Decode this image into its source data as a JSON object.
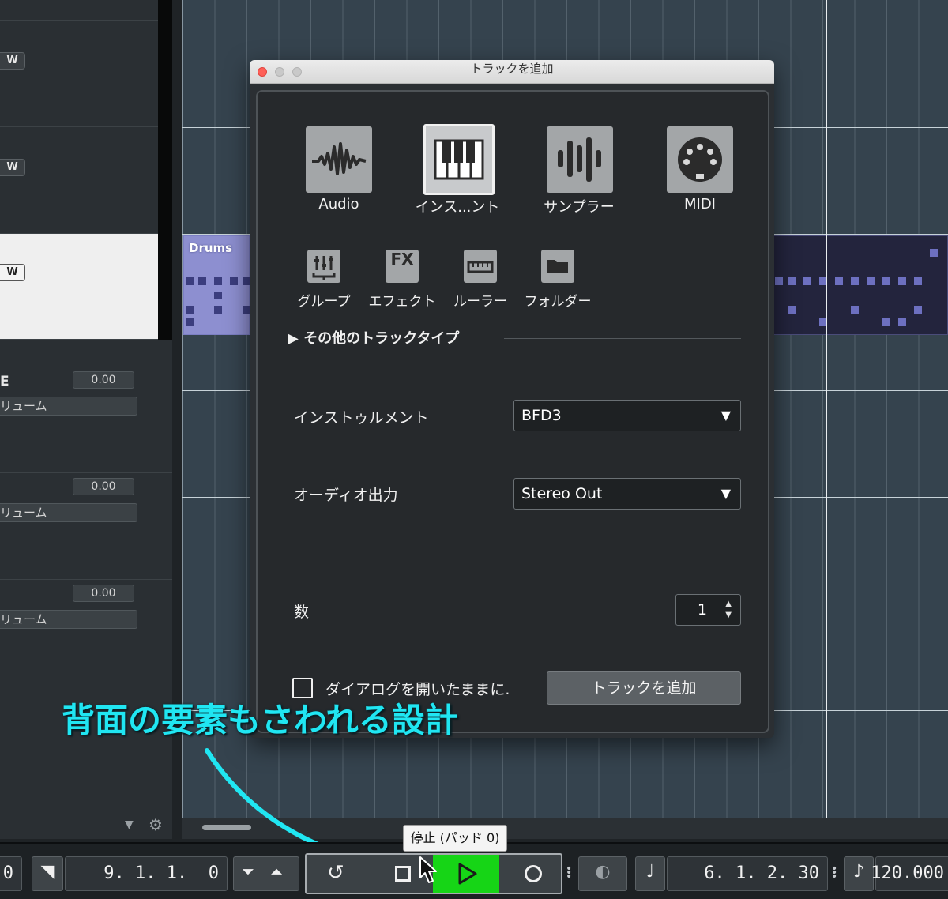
{
  "tracks": {
    "w_label": "W",
    "rows": [
      {
        "name": "E",
        "value": "0.00",
        "volume": "リューム"
      },
      {
        "name": "",
        "value": "0.00",
        "volume": "リューム"
      },
      {
        "name": "",
        "value": "0.00",
        "volume": "リューム"
      }
    ]
  },
  "arrange": {
    "part_name": "Drums"
  },
  "dialog": {
    "title": "トラックを追加",
    "big_types": [
      {
        "label": "Audio",
        "icon": "waveform-icon"
      },
      {
        "label": "インス...ント",
        "icon": "keyboard-icon"
      },
      {
        "label": "サンプラー",
        "icon": "sampler-bars-icon"
      },
      {
        "label": "MIDI",
        "icon": "midi-port-icon"
      }
    ],
    "small_types": [
      {
        "label": "グループ",
        "icon": "group-faders-icon"
      },
      {
        "label": "エフェクト",
        "icon": "fx-icon",
        "glyph": "FX"
      },
      {
        "label": "ルーラー",
        "icon": "ruler-icon"
      },
      {
        "label": "フォルダー",
        "icon": "folder-icon"
      }
    ],
    "other_types_label": "▶  その他のトラックタイプ",
    "instrument_label": "インストゥルメント",
    "instrument_value": "BFD3",
    "audio_out_label": "オーディオ出力",
    "audio_out_value": "Stereo Out",
    "count_label": "数",
    "count_value": "1",
    "keep_open_label": "ダイアログを開いたままに.",
    "add_button_label": "トラックを追加"
  },
  "annotation": "背面の要素もさわれる設計",
  "transport": {
    "left_counter": "0",
    "locator_left": "9. 1. 1.  0",
    "locator_right": "6. 1. 2. 30",
    "tempo": "120.000",
    "tooltip": "停止 (パッド 0)"
  },
  "colors": {
    "play_active": "#16d516",
    "annotation": "#20e6f2",
    "close_light": "#fe5f57",
    "midi_part": "#8d8fd0"
  }
}
